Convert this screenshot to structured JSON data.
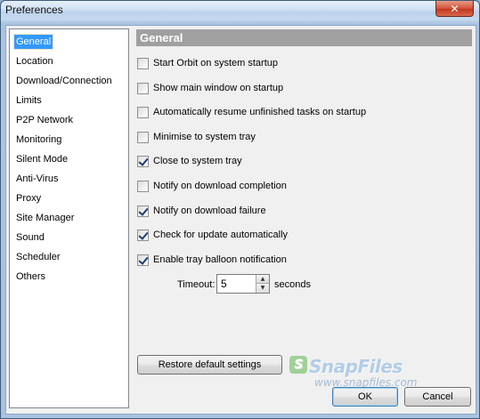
{
  "window": {
    "title": "Preferences",
    "close_glyph": "✕"
  },
  "nav": {
    "items": [
      {
        "label": "General",
        "selected": true
      },
      {
        "label": "Location"
      },
      {
        "label": "Download/Connection"
      },
      {
        "label": "Limits"
      },
      {
        "label": "P2P Network"
      },
      {
        "label": "Monitoring"
      },
      {
        "label": "Silent Mode"
      },
      {
        "label": "Anti-Virus"
      },
      {
        "label": "Proxy"
      },
      {
        "label": "Site Manager"
      },
      {
        "label": "Sound"
      },
      {
        "label": "Scheduler"
      },
      {
        "label": "Others"
      }
    ]
  },
  "section": {
    "title": "General"
  },
  "options": [
    {
      "label": "Start Orbit on system startup",
      "checked": false
    },
    {
      "label": "Show main window on startup",
      "checked": false
    },
    {
      "label": "Automatically resume unfinished tasks on startup",
      "checked": false
    },
    {
      "label": "Minimise to system tray",
      "checked": false
    },
    {
      "label": "Close to system tray",
      "checked": true
    },
    {
      "label": "Notify on download completion",
      "checked": false
    },
    {
      "label": "Notify on download failure",
      "checked": true
    },
    {
      "label": "Check for update automatically",
      "checked": true
    },
    {
      "label": "Enable tray balloon notification",
      "checked": true
    }
  ],
  "timeout": {
    "label": "Timeout:",
    "value": "5",
    "unit": "seconds"
  },
  "buttons": {
    "restore": "Restore default settings",
    "ok": "OK",
    "cancel": "Cancel"
  },
  "watermark": {
    "logo_text": "SnapFiles",
    "url": "www.snapfiles.com"
  },
  "colors": {
    "selection": "#3399ff",
    "header_bg": "#a0a0a0",
    "frame": "#a9c2df"
  }
}
